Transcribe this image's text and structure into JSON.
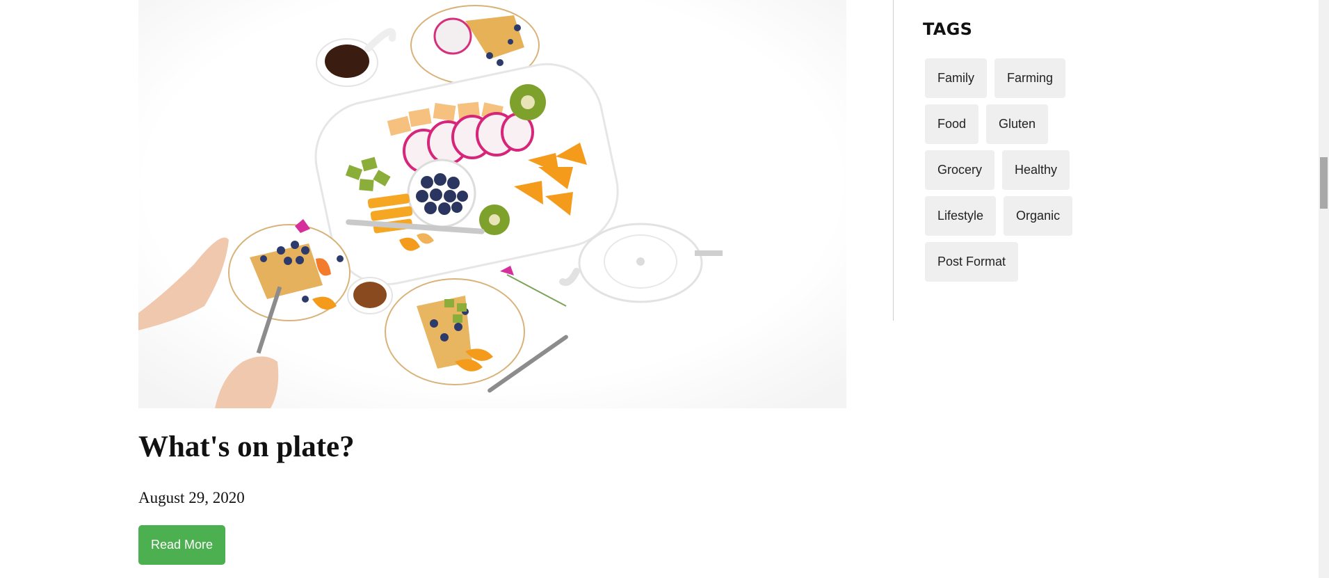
{
  "post": {
    "image_alt": "Overhead view of a white table with fruit platter, pancakes, syrup and teapot",
    "title": "What's on plate?",
    "date": "August 29, 2020",
    "read_more_label": "Read More"
  },
  "sidebar": {
    "heading": "TAGS",
    "tags": [
      "Family",
      "Farming",
      "Food",
      "Gluten",
      "Grocery",
      "Healthy",
      "Lifestyle",
      "Organic",
      "Post Format"
    ]
  },
  "colors": {
    "accent_button": "#4caf50",
    "tag_background": "#efefef",
    "divider": "#cfcfcf",
    "page_background": "#ffffff"
  }
}
